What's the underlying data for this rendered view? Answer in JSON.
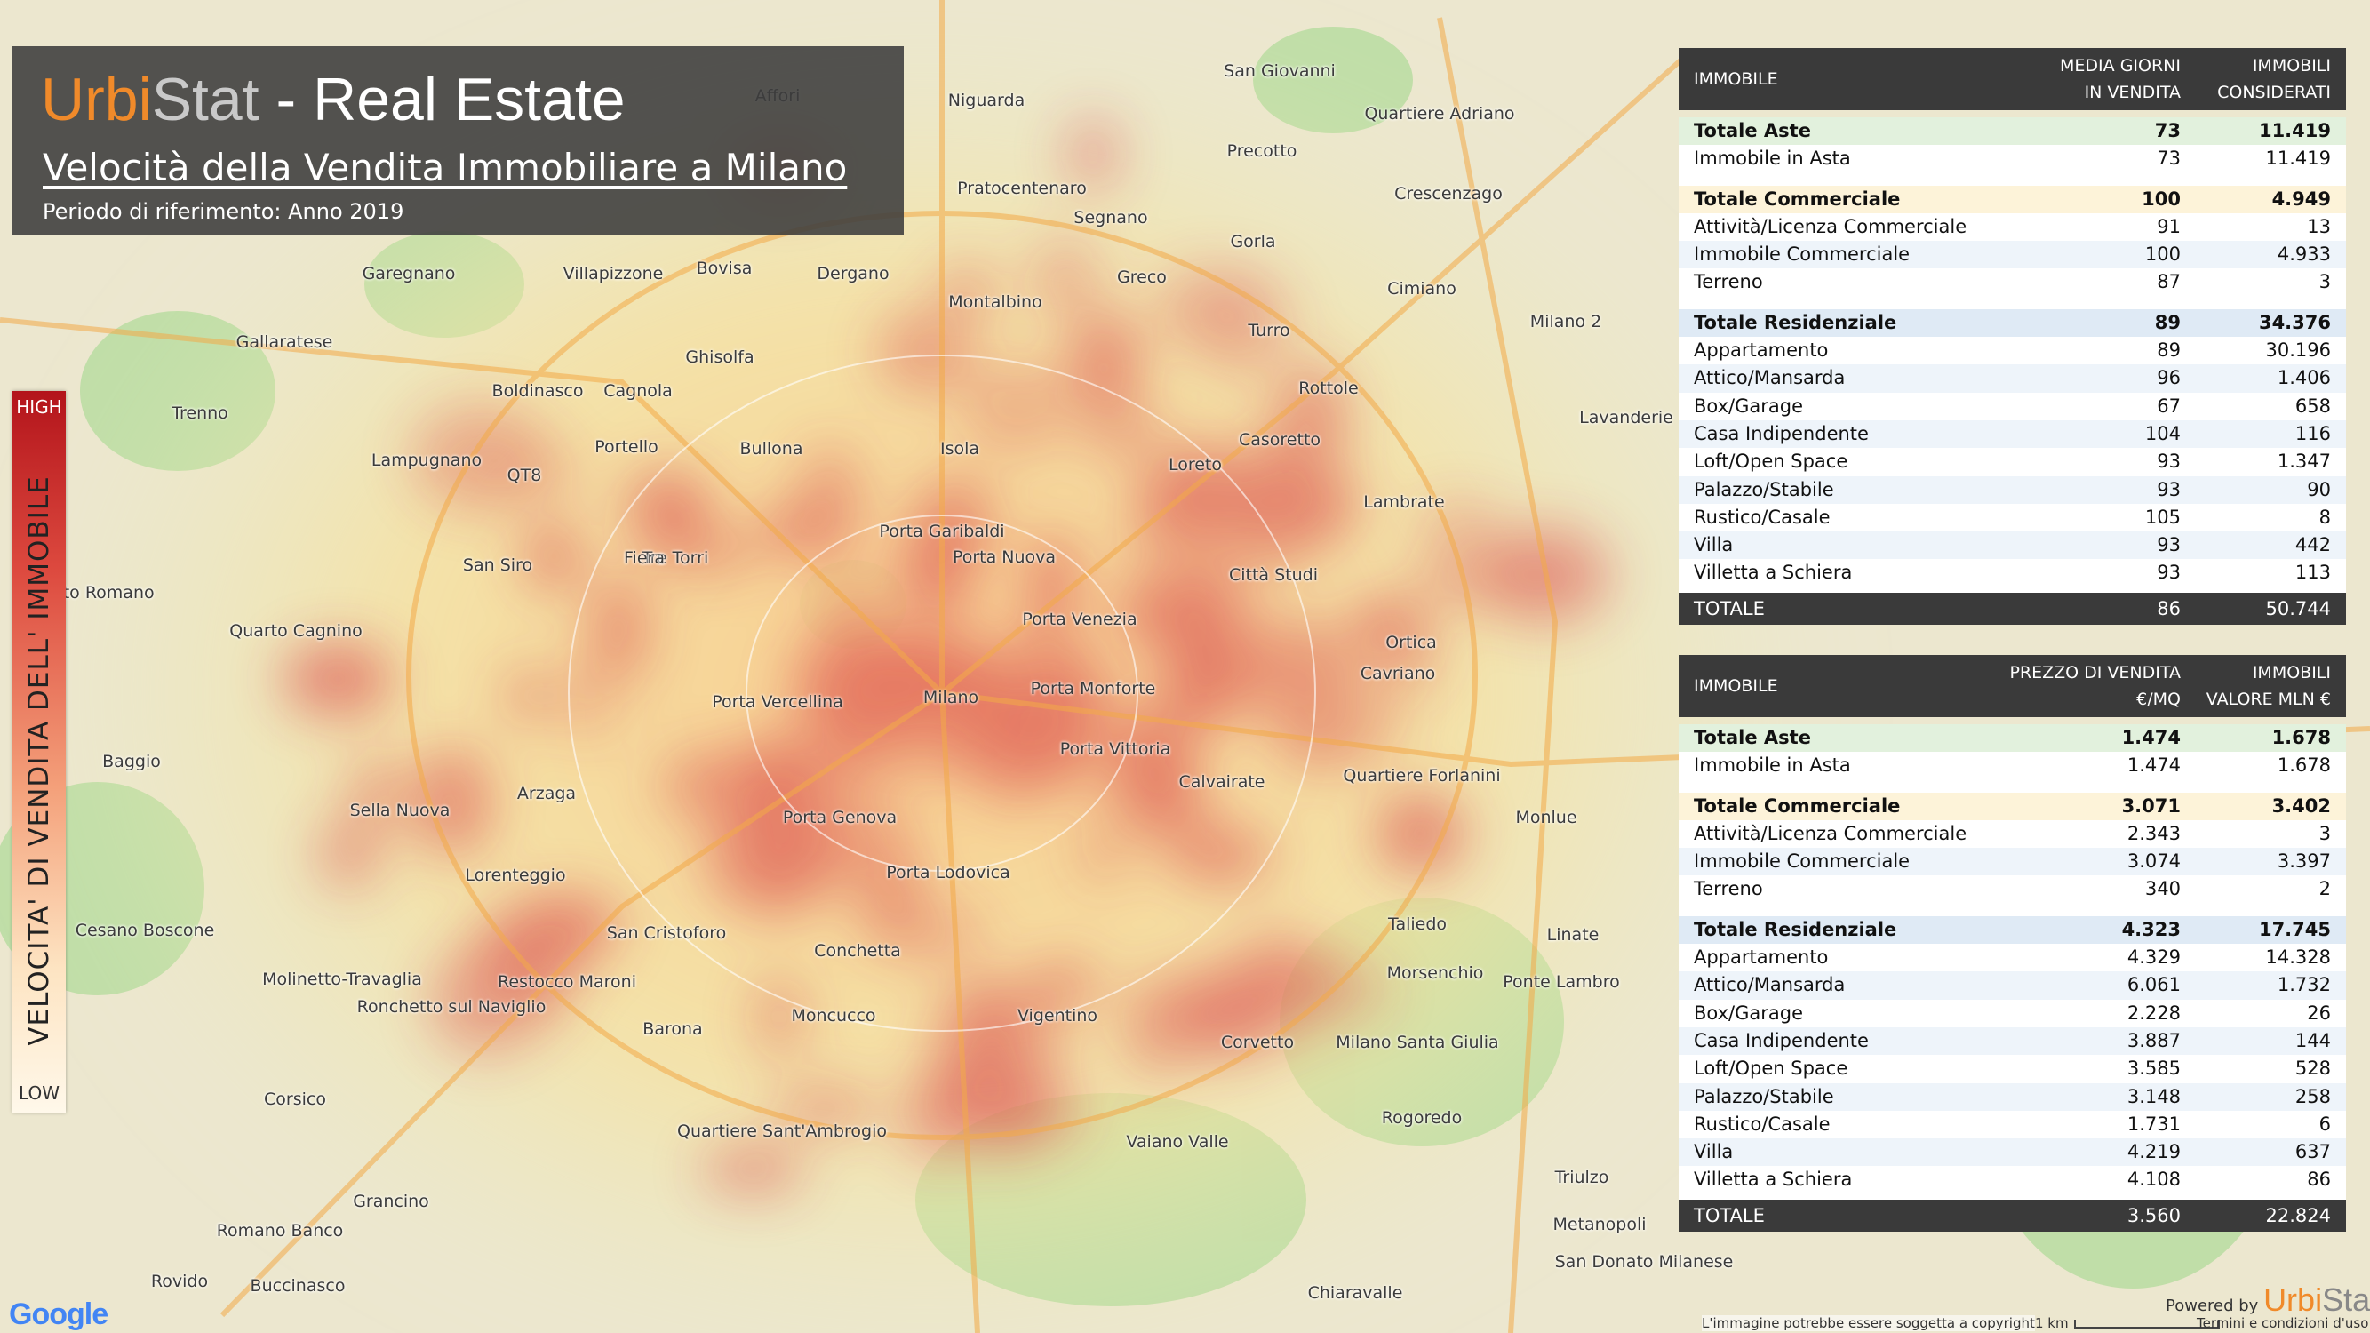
{
  "header": {
    "brand_urbi": "Urbi",
    "brand_stat": "Stat",
    "brand_rest": " - Real Estate",
    "subtitle": "Velocità della Vendita Immobiliare a Milano",
    "period": "Periodo di riferimento: Anno 2019"
  },
  "legend": {
    "high": "HIGH",
    "low": "LOW",
    "title": "VELOCITA' DI VENDITA  DELL' IMMOBILE",
    "color_high": "#b3141b",
    "color_low": "#fff8ea"
  },
  "table1": {
    "col_name": "IMMOBILE",
    "col1_line1": "MEDIA GIORNI",
    "col1_line2": "IN VENDITA",
    "col2_line1": "IMMOBILI",
    "col2_line2": "CONSIDERATI",
    "rows": [
      {
        "name": "Totale Aste",
        "v1": "73",
        "v2": "11.419",
        "kind": "total aste"
      },
      {
        "name": "Immobile in Asta",
        "v1": "73",
        "v2": "11.419",
        "kind": ""
      },
      {
        "name": "Totale Commerciale",
        "v1": "100",
        "v2": "4.949",
        "kind": "total comm"
      },
      {
        "name": "Attività/Licenza Commerciale",
        "v1": "91",
        "v2": "13",
        "kind": ""
      },
      {
        "name": "Immobile Commerciale",
        "v1": "100",
        "v2": "4.933",
        "kind": "alt"
      },
      {
        "name": "Terreno",
        "v1": "87",
        "v2": "3",
        "kind": ""
      },
      {
        "name": "Totale Residenziale",
        "v1": "89",
        "v2": "34.376",
        "kind": "total res"
      },
      {
        "name": "Appartamento",
        "v1": "89",
        "v2": "30.196",
        "kind": ""
      },
      {
        "name": "Attico/Mansarda",
        "v1": "96",
        "v2": "1.406",
        "kind": "alt"
      },
      {
        "name": "Box/Garage",
        "v1": "67",
        "v2": "658",
        "kind": ""
      },
      {
        "name": "Casa Indipendente",
        "v1": "104",
        "v2": "116",
        "kind": "alt"
      },
      {
        "name": "Loft/Open Space",
        "v1": "93",
        "v2": "1.347",
        "kind": ""
      },
      {
        "name": "Palazzo/Stabile",
        "v1": "93",
        "v2": "90",
        "kind": "alt"
      },
      {
        "name": "Rustico/Casale",
        "v1": "105",
        "v2": "8",
        "kind": ""
      },
      {
        "name": "Villa",
        "v1": "93",
        "v2": "442",
        "kind": "alt"
      },
      {
        "name": "Villetta a Schiera",
        "v1": "93",
        "v2": "113",
        "kind": ""
      }
    ],
    "total_label": "TOTALE",
    "total_v1": "86",
    "total_v2": "50.744"
  },
  "table2": {
    "col_name": "IMMOBILE",
    "col1_line1": "PREZZO DI VENDITA",
    "col1_line2": "€/MQ",
    "col2_line1": "IMMOBILI",
    "col2_line2": "VALORE MLN €",
    "rows": [
      {
        "name": "Totale Aste",
        "v1": "1.474",
        "v2": "1.678",
        "kind": "total aste"
      },
      {
        "name": "Immobile in Asta",
        "v1": "1.474",
        "v2": "1.678",
        "kind": ""
      },
      {
        "name": "Totale Commerciale",
        "v1": "3.071",
        "v2": "3.402",
        "kind": "total comm"
      },
      {
        "name": "Attività/Licenza Commerciale",
        "v1": "2.343",
        "v2": "3",
        "kind": ""
      },
      {
        "name": "Immobile Commerciale",
        "v1": "3.074",
        "v2": "3.397",
        "kind": "alt"
      },
      {
        "name": "Terreno",
        "v1": "340",
        "v2": "2",
        "kind": ""
      },
      {
        "name": "Totale Residenziale",
        "v1": "4.323",
        "v2": "17.745",
        "kind": "total res"
      },
      {
        "name": "Appartamento",
        "v1": "4.329",
        "v2": "14.328",
        "kind": ""
      },
      {
        "name": "Attico/Mansarda",
        "v1": "6.061",
        "v2": "1.732",
        "kind": "alt"
      },
      {
        "name": "Box/Garage",
        "v1": "2.228",
        "v2": "26",
        "kind": ""
      },
      {
        "name": "Casa Indipendente",
        "v1": "3.887",
        "v2": "144",
        "kind": "alt"
      },
      {
        "name": "Loft/Open Space",
        "v1": "3.585",
        "v2": "528",
        "kind": ""
      },
      {
        "name": "Palazzo/Stabile",
        "v1": "3.148",
        "v2": "258",
        "kind": "alt"
      },
      {
        "name": "Rustico/Casale",
        "v1": "1.731",
        "v2": "6",
        "kind": ""
      },
      {
        "name": "Villa",
        "v1": "4.219",
        "v2": "637",
        "kind": "alt"
      },
      {
        "name": "Villetta a Schiera",
        "v1": "4.108",
        "v2": "86",
        "kind": ""
      }
    ],
    "total_label": "TOTALE",
    "total_v1": "3.560",
    "total_v2": "22.824"
  },
  "map_labels": [
    "Affori",
    "Niguarda",
    "San Giovanni",
    "Quartiere Adriano",
    "Precotto",
    "Pratocentenaro",
    "Crescenzago",
    "Gorla",
    "Segnano",
    "Garegnano",
    "Villapizzone",
    "Bovisa",
    "Dergano",
    "Greco",
    "Cimiano",
    "Gallaratese",
    "Montalbino",
    "Turro",
    "Ghisolfa",
    "Boldinasco",
    "Cagnola",
    "Rottole",
    "Trenno",
    "Lampugnano",
    "QT8",
    "Portello",
    "Bullona",
    "Isola",
    "Loreto",
    "Casoretto",
    "Lambrate",
    "Porta Garibaldi",
    "Porta Nuova",
    "San Siro",
    "Tre Torri",
    "Fiera",
    "Città Studi",
    "Quarto Cagnino",
    "Porta Venezia",
    "Baggio",
    "Porta Vercellina",
    "Milano",
    "Porta Monforte",
    "Ortica",
    "Cavriano",
    "Porta Vittoria",
    "Quartiere Forlanini",
    "Sella Nuova",
    "Arzaga",
    "Porta Genova",
    "Calvairate",
    "Lorenteggio",
    "Porta Lodovica",
    "Monlue",
    "Cesano Boscone",
    "San Cristoforo",
    "Conchetta",
    "Taliedo",
    "Morsenchio",
    "Molinetto-Travaglia",
    "Restocco Maroni",
    "Ponte Lambro",
    "Ronchetto sul Naviglio",
    "Barona",
    "Moncucco",
    "Vigentino",
    "Corvetto",
    "Milano Santa Giulia",
    "Corsico",
    "Rogoredo",
    "Quartiere Sant'Ambrogio",
    "Vaiano Valle",
    "Triulzo",
    "Grancino",
    "Romano Banco",
    "Metanopoli",
    "San Donato Milanese",
    "Rovido",
    "Buccinasco",
    "Chiaravalle",
    "Lavanderie",
    "Milano 2",
    "Linate",
    "Quinto Romano"
  ],
  "footer": {
    "google": "Google",
    "credits": "L'immagine potrebbe essere soggetta a copyright",
    "scale": "1 km",
    "terms": "Termini e condizioni d'uso",
    "powered_by": "Powered by",
    "brand_urbi": "Urbi",
    "brand_stat": "Stat"
  },
  "colors": {
    "brand_orange": "#f08a2a",
    "panel_dark": "#3a3a3a",
    "row_aste": "#e2f1dd",
    "row_comm": "#fdf3d9",
    "row_res": "#dfeaf5"
  }
}
